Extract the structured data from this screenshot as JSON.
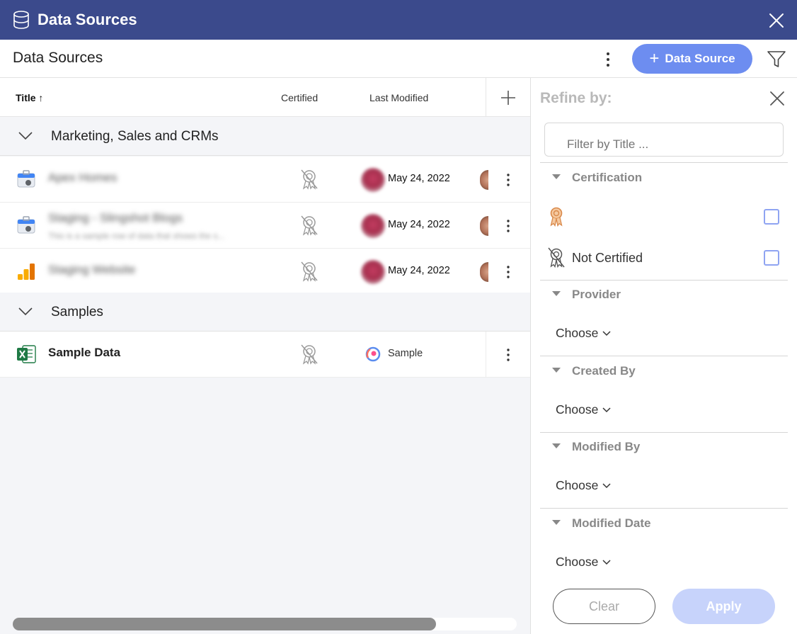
{
  "window": {
    "title": "Data Sources",
    "icon": "database-icon",
    "close_icon": "close-icon"
  },
  "toolbar": {
    "heading": "Data Sources",
    "add_label": "Data Source",
    "add_icon": "plus-icon",
    "more_icon": "kebab-icon",
    "filter_icon": "filter-icon"
  },
  "table": {
    "columns": {
      "title": "Title",
      "sort_icon": "arrow-up-icon",
      "certified": "Certified",
      "last_modified": "Last Modified",
      "add_icon": "plus-icon"
    },
    "groups": [
      {
        "label": "Marketing, Sales and CRMs",
        "rows": [
          {
            "name": "Apex Homes",
            "subtitle": "",
            "date": "May 24, 2022"
          },
          {
            "name": "Staging - Slingshot Blogs",
            "subtitle": "This is a sample row of data that shows the s...",
            "date": "May 24, 2022"
          },
          {
            "name": "Staging Website",
            "subtitle": "",
            "date": "May 24, 2022"
          }
        ]
      },
      {
        "label": "Samples",
        "rows": [
          {
            "name": "Sample Data",
            "subtitle": "",
            "modified_by": "Sample"
          }
        ]
      }
    ],
    "scroll_position": 0.84
  },
  "refine": {
    "title": "Refine by:",
    "search_placeholder": "Filter by Title ...",
    "sections": {
      "certification": "Certification",
      "provider": "Provider",
      "created_by": "Created By",
      "modified_by": "Modified By",
      "modified_date": "Modified Date"
    },
    "certification_options": {
      "not_certified": "Not Certified"
    },
    "choose_label": "Choose",
    "clear_label": "Clear",
    "apply_label": "Apply"
  },
  "colors": {
    "titlebar": "#3b4a8c",
    "accent": "#6d8df0",
    "apply_disabled": "#c7d3fb",
    "certified_badge": "#d9894a"
  }
}
